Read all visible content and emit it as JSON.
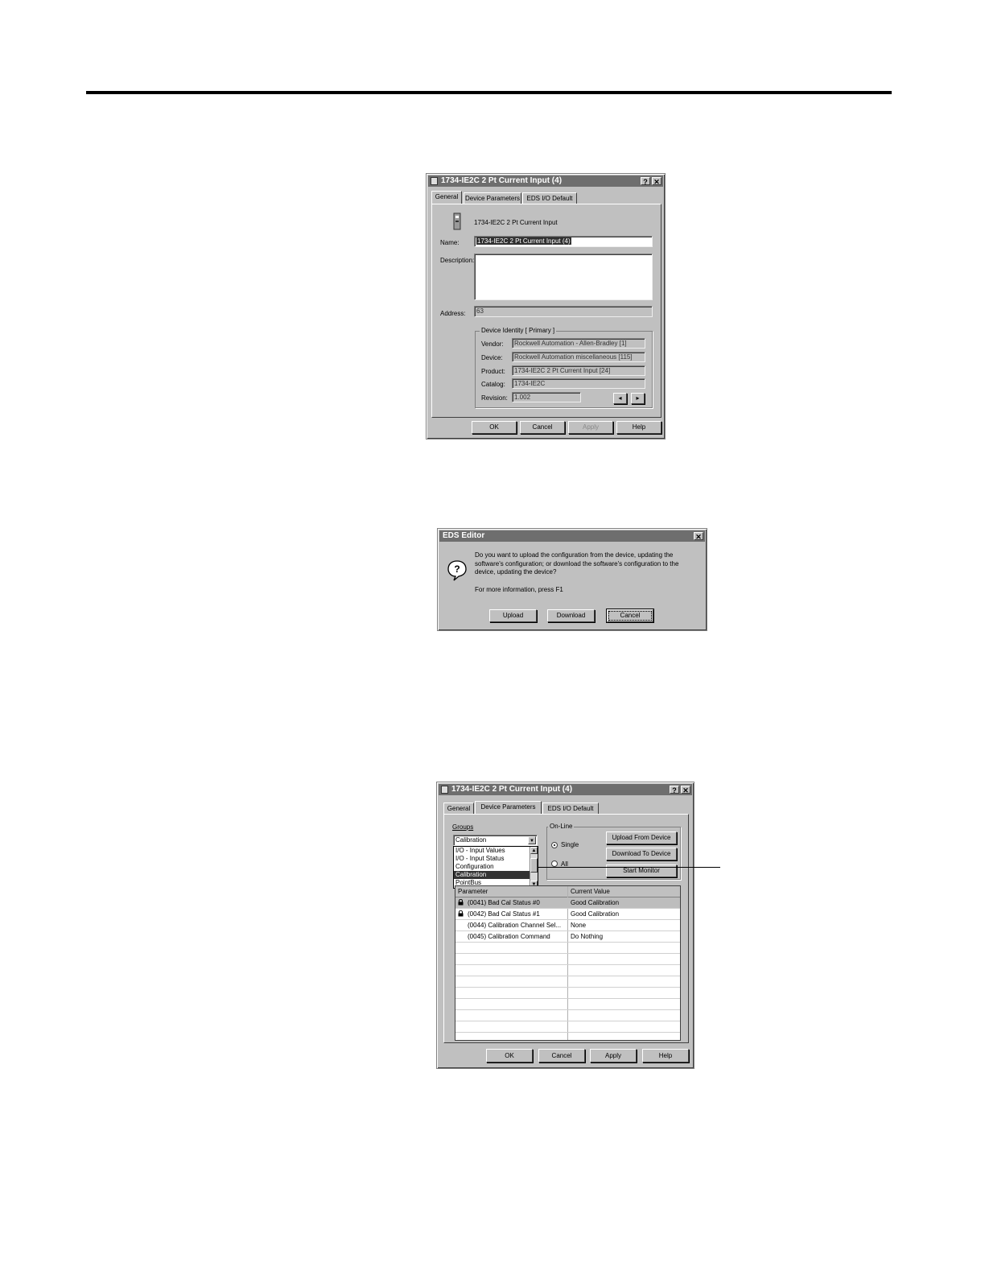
{
  "dialog1": {
    "title": "1734-IE2C 2 Pt Current Input (4)",
    "tabs": [
      "General",
      "Device Parameters",
      "EDS I/O Default"
    ],
    "device_label": "1734-IE2C 2 Pt Current Input",
    "name_label": "Name:",
    "name_value": "1734-IE2C 2 Pt Current Input (4)",
    "description_label": "Description:",
    "address_label": "Address:",
    "address_value": "63",
    "identity_group": "Device Identity [ Primary ]",
    "vendor_label": "Vendor:",
    "vendor_value": "Rockwell Automation - Allen-Bradley [1]",
    "device_label2": "Device:",
    "device_value": "Rockwell Automation miscellaneous [115]",
    "product_label": "Product:",
    "product_value": "1734-IE2C 2 Pt Current Input [24]",
    "catalog_label": "Catalog:",
    "catalog_value": "1734-IE2C",
    "revision_label": "Revision:",
    "revision_value": "1.002",
    "buttons": {
      "ok": "OK",
      "cancel": "Cancel",
      "apply": "Apply",
      "help": "Help"
    }
  },
  "dialog2": {
    "title": "EDS Editor",
    "message": "Do you want to upload the configuration from the device, updating the software's configuration; or download the software's configuration to the device, updating the device?",
    "info": "For more information, press F1",
    "buttons": {
      "upload": "Upload",
      "download": "Download",
      "cancel": "Cancel"
    }
  },
  "dialog3": {
    "title": "1734-IE2C 2 Pt Current Input (4)",
    "tabs": [
      "General",
      "Device Parameters",
      "EDS I/O Default"
    ],
    "groups_label": "Groups",
    "groups_selected": "Calibration",
    "groups_options": [
      "I/O - Input Values",
      "I/O - Input Status",
      "Configuration",
      "Calibration",
      "PointBus"
    ],
    "online_group": "On-Line",
    "single_label": "Single",
    "all_label": "All",
    "upload_btn": "Upload From Device",
    "download_btn": "Download To Device",
    "monitor_btn": "Start Monitor",
    "columns": [
      "Parameter",
      "Current Value"
    ],
    "rows": [
      {
        "param": "(0041) Bad Cal Status #0",
        "value": "Good Calibration",
        "locked": true
      },
      {
        "param": "(0042) Bad Cal Status #1",
        "value": "Good Calibration",
        "locked": true
      },
      {
        "param": "(0044) Calibration Channel Sel...",
        "value": "None",
        "locked": false
      },
      {
        "param": "(0045) Calibration Command",
        "value": "Do Nothing",
        "locked": false
      }
    ],
    "buttons": {
      "ok": "OK",
      "cancel": "Cancel",
      "apply": "Apply",
      "help": "Help"
    }
  }
}
